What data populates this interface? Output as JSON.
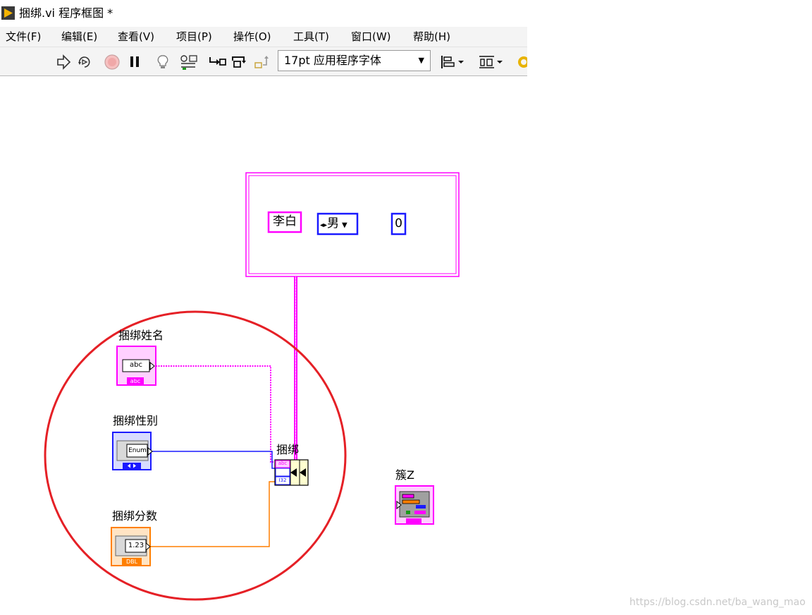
{
  "window": {
    "title": "捆绑.vi 程序框图 *"
  },
  "menu": [
    {
      "label": "文件(F)"
    },
    {
      "label": "编辑(E)"
    },
    {
      "label": "查看(V)"
    },
    {
      "label": "项目(P)"
    },
    {
      "label": "操作(O)"
    },
    {
      "label": "工具(T)"
    },
    {
      "label": "窗口(W)"
    },
    {
      "label": "帮助(H)"
    }
  ],
  "toolbar": {
    "icons": [
      "run-arrow-icon",
      "run-continuously-icon",
      "abort-icon",
      "pause-icon",
      "highlight-execution-icon",
      "retain-wire-values-icon",
      "step-into-icon",
      "step-over-icon",
      "step-out-icon",
      "align-objects-icon",
      "distribute-objects-icon",
      "clean-up-icon"
    ],
    "font_select": "17pt 应用程序字体"
  },
  "diagram": {
    "cluster_constant": {
      "name_value": "李白",
      "gender_value": "男",
      "score_value": "0"
    },
    "controls": {
      "name": {
        "label": "捆绑姓名",
        "inner": "abc",
        "type": "abc"
      },
      "gender": {
        "label": "捆绑性别",
        "inner": "Enum"
      },
      "score": {
        "label": "捆绑分数",
        "inner": "1.23",
        "type": "DBL"
      }
    },
    "bundle_node": {
      "label": "捆绑",
      "rows": [
        "abc",
        "",
        "I32"
      ]
    },
    "cluster_indicator": {
      "label": "簇Z"
    },
    "colors": {
      "string": "#ff00ff",
      "enum": "#0000ff",
      "dbl": "#ff7f00",
      "annotation": "#e52026"
    }
  },
  "watermark": "https://blog.csdn.net/ba_wang_mao"
}
